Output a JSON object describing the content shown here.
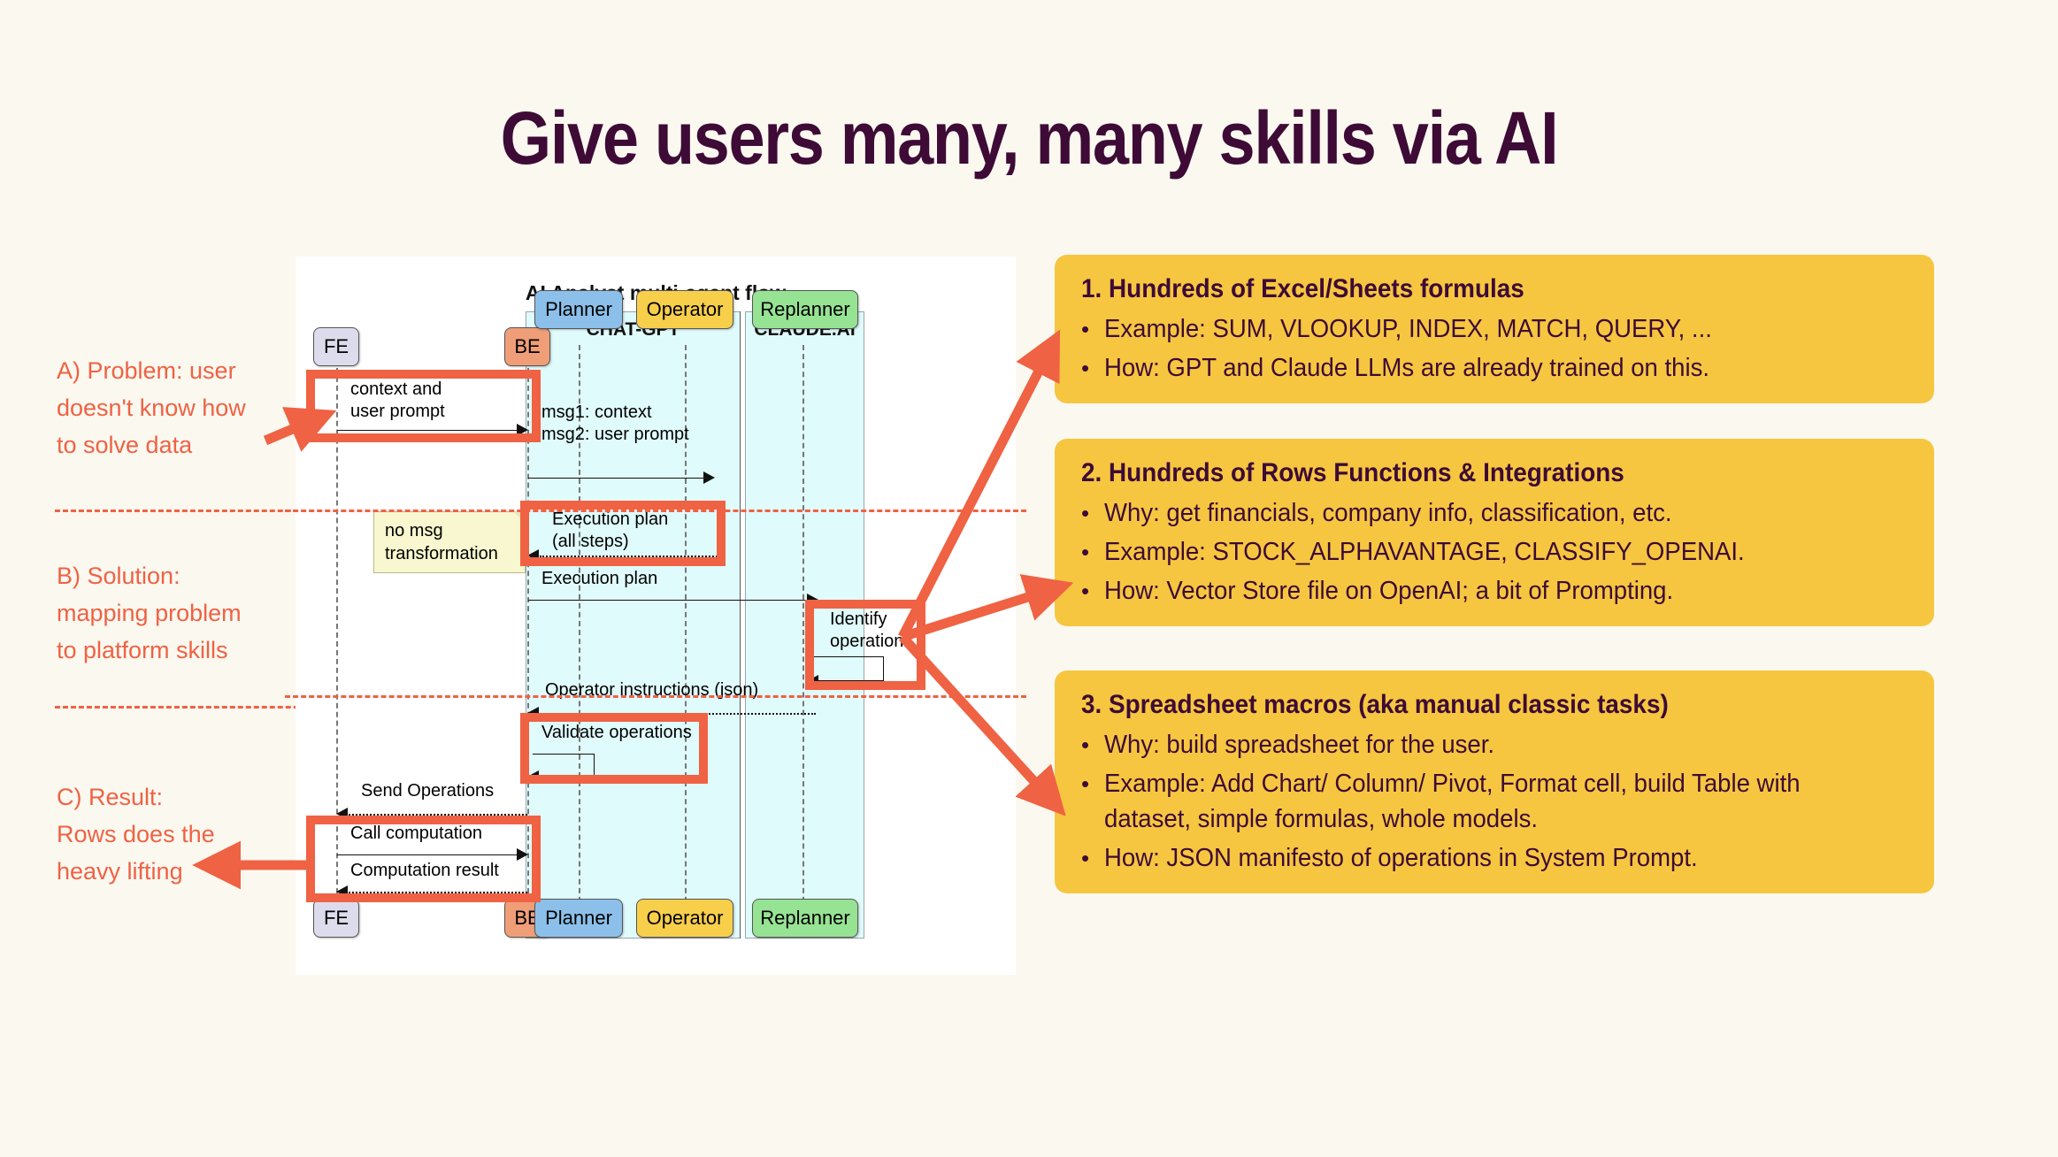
{
  "page": {
    "title": "Give users many, many skills via AI",
    "background_color": "#fbf8f0",
    "title_color": "#3d0b36",
    "accent_color": "#ef6243",
    "card_color": "#f6c640"
  },
  "left_annotations": [
    {
      "id": "A",
      "text": "A) Problem: user\ndoesn't know how\nto solve data"
    },
    {
      "id": "B",
      "text": "B) Solution:\nmapping problem\nto platform skills"
    },
    {
      "id": "C",
      "text": "C) Result:\nRows does the\nheavy lifting"
    }
  ],
  "diagram": {
    "title": "AI Analyst multi-agent flow",
    "groups": [
      {
        "label": "CHAT-GPT",
        "color": "#e0fbfc"
      },
      {
        "label": "CLAUDE.AI",
        "color": "#e0fbfc"
      }
    ],
    "participants": [
      {
        "name": "FE",
        "color": "#dcdcec"
      },
      {
        "name": "BE",
        "color": "#ef9e78"
      },
      {
        "name": "Planner",
        "color": "#8cc0ea"
      },
      {
        "name": "Operator",
        "color": "#f8cf4b"
      },
      {
        "name": "Replanner",
        "color": "#97e394"
      }
    ],
    "messages": [
      {
        "label": "context and\nuser prompt",
        "from": "FE",
        "to": "BE",
        "style": "solid",
        "highlighted": true
      },
      {
        "label": "msg1: context\nmsg2: user prompt",
        "from": "BE",
        "to": "Planner",
        "style": "solid",
        "highlighted": false
      },
      {
        "label": "Execution plan\n(all steps)",
        "from": "Planner",
        "to": "BE",
        "style": "dotted",
        "highlighted": true
      },
      {
        "label": "Execution plan",
        "from": "BE",
        "to": "Operator",
        "style": "solid",
        "highlighted": false
      },
      {
        "label": "Identify\noperations",
        "from": "Operator",
        "to": "Operator",
        "style": "self",
        "highlighted": true
      },
      {
        "label": "Operator instructions (json)",
        "from": "Operator",
        "to": "BE",
        "style": "dotted",
        "highlighted": false
      },
      {
        "label": "Validate operations",
        "from": "BE",
        "to": "BE",
        "style": "self",
        "highlighted": true
      },
      {
        "label": "Send Operations",
        "from": "BE",
        "to": "FE",
        "style": "dotted",
        "highlighted": false
      },
      {
        "label": "Call computation",
        "from": "FE",
        "to": "BE",
        "style": "solid",
        "highlighted": true
      },
      {
        "label": "Computation result",
        "from": "BE",
        "to": "FE",
        "style": "dotted",
        "highlighted": true
      }
    ],
    "note": {
      "text": "no msg\ntransformation",
      "color": "#f8f7cf"
    }
  },
  "cards": [
    {
      "title": "1. Hundreds of Excel/Sheets formulas",
      "bullets": [
        "Example: SUM, VLOOKUP, INDEX, MATCH, QUERY, ...",
        "How: GPT and Claude LLMs are already trained on this."
      ]
    },
    {
      "title": "2. Hundreds of Rows Functions & Integrations",
      "bullets": [
        "Why: get financials, company info, classification, etc.",
        "Example: STOCK_ALPHAVANTAGE, CLASSIFY_OPENAI.",
        "How: Vector Store file on OpenAI; a bit of Prompting."
      ]
    },
    {
      "title": "3. Spreadsheet macros (aka manual classic tasks)",
      "bullets": [
        "Why: build spreadsheet for the user.",
        "Example: Add Chart/ Column/ Pivot, Format cell, build Table with dataset, simple formulas, whole models.",
        "How: JSON manifesto of operations in System Prompt."
      ]
    }
  ]
}
